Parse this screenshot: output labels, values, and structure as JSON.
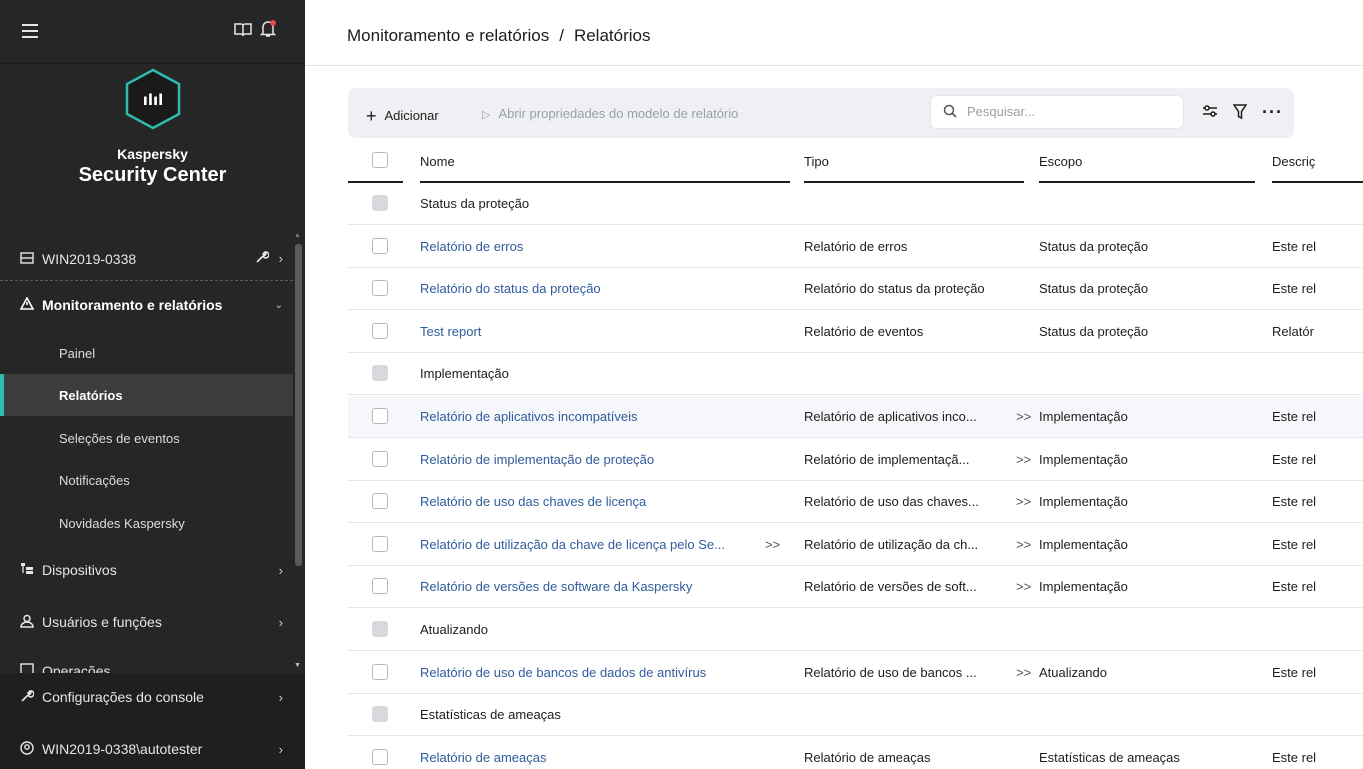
{
  "sidebar": {
    "brand_line1": "Kaspersky",
    "brand_line2": "Security Center",
    "logo_text": "ılıl",
    "device": "WIN2019-0338",
    "monitoring": "Monitoramento e relatórios",
    "sub_items": [
      "Painel",
      "Relatórios",
      "Seleções de eventos",
      "Notificações",
      "Novidades Kaspersky"
    ],
    "devices": "Dispositivos",
    "users_roles": "Usuários e funções",
    "operations": "Operações",
    "console_settings": "Configurações do console",
    "user": "WIN2019-0338\\autotester",
    "accent_color": "#2dbcad"
  },
  "header": {
    "breadcrumb_parent": "Monitoramento e relatórios",
    "breadcrumb_sep": "/",
    "breadcrumb_current": "Relatórios"
  },
  "toolbar": {
    "add_label": "Adicionar",
    "open_label": "Abrir propriedades do modelo de relatório",
    "search_placeholder": "Pesquisar..."
  },
  "table": {
    "columns": [
      "Nome",
      "Tipo",
      "Escopo",
      "Descriç"
    ],
    "rows": [
      {
        "group": true,
        "name": "Status da proteção"
      },
      {
        "name": "Relatório de erros",
        "type": "Relatório de erros",
        "scope": "Status da proteção",
        "desc": "Este rel"
      },
      {
        "name": "Relatório do status da proteção",
        "type": "Relatório do status da proteção",
        "scope": "Status da proteção",
        "desc": "Este rel"
      },
      {
        "name": "Test report",
        "type": "Relatório de eventos",
        "scope": "Status da proteção",
        "desc": "Relatór"
      },
      {
        "group": true,
        "name": "Implementação"
      },
      {
        "name": "Relatório de aplicativos incompatíveis",
        "type": "Relatório de aplicativos inco...",
        "type_more": ">>",
        "scope": "Implementação",
        "desc": "Este rel"
      },
      {
        "name": "Relatório de implementação de proteção",
        "type": "Relatório de implementaçã...",
        "type_more": ">>",
        "scope": "Implementação",
        "desc": "Este rel"
      },
      {
        "name": "Relatório de uso das chaves de licença",
        "type": "Relatório de uso das chaves...",
        "type_more": ">>",
        "scope": "Implementação",
        "desc": "Este rel"
      },
      {
        "name": "Relatório de utilização da chave de licença pelo Se...",
        "name_more": ">>",
        "type": "Relatório de utilização da ch...",
        "type_more": ">>",
        "scope": "Implementação",
        "desc": "Este rel"
      },
      {
        "name": "Relatório de versões de software da Kaspersky",
        "type": "Relatório de versões de soft...",
        "type_more": ">>",
        "scope": "Implementação",
        "desc": "Este rel"
      },
      {
        "group": true,
        "name": "Atualizando"
      },
      {
        "name": "Relatório de uso de bancos de dados de antivírus",
        "type": "Relatório de uso de bancos ...",
        "type_more": ">>",
        "scope": "Atualizando",
        "desc": "Este rel"
      },
      {
        "group": true,
        "name": "Estatísticas de ameaças"
      },
      {
        "name": "Relatório de ameaças",
        "type": "Relatório de ameaças",
        "scope": "Estatísticas de ameaças",
        "desc": "Este rel"
      }
    ]
  }
}
